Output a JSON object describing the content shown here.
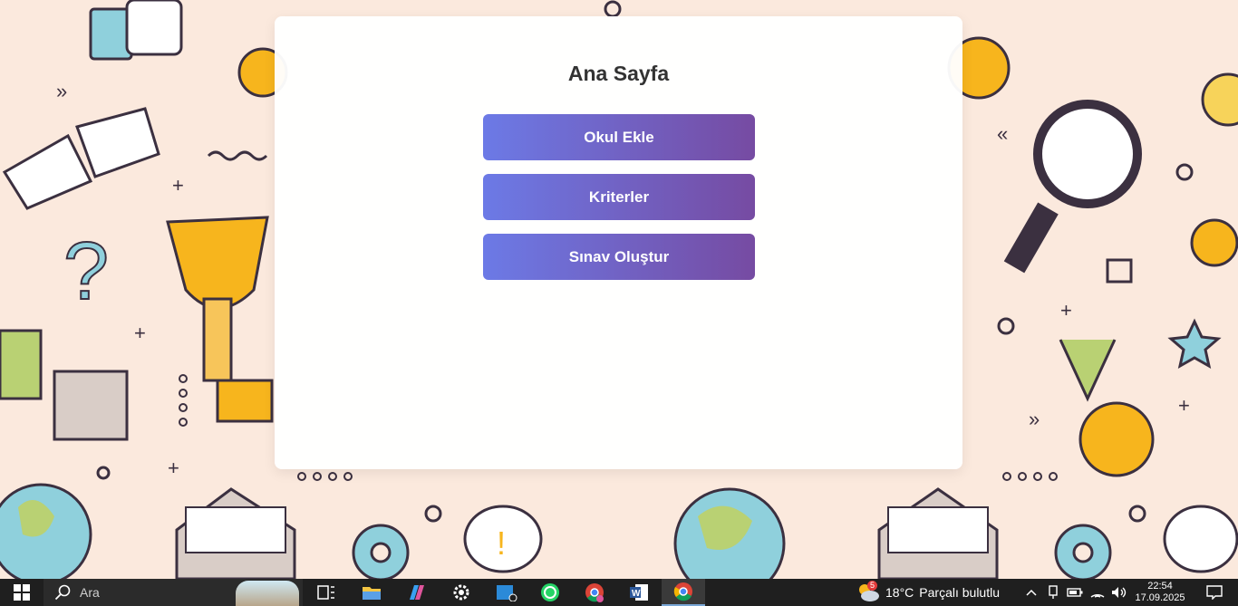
{
  "page": {
    "title": "Ana Sayfa",
    "buttons": {
      "okul_ekle": "Okul Ekle",
      "kriterler": "Kriterler",
      "sinav_olustur": "Sınav Oluştur"
    },
    "button_gradient": [
      "#6c7ae6",
      "#764ba2"
    ]
  },
  "taskbar": {
    "search_placeholder": "Ara",
    "weather": {
      "badge": "5",
      "temperature": "18°C",
      "description": "Parçalı bulutlu"
    },
    "clock": {
      "time": "22:54",
      "date": "17.09.2025"
    },
    "apps": [
      "task-view",
      "file-explorer",
      "copilot",
      "settings",
      "mail",
      "whatsapp",
      "chrome-profile",
      "word",
      "chrome"
    ]
  }
}
